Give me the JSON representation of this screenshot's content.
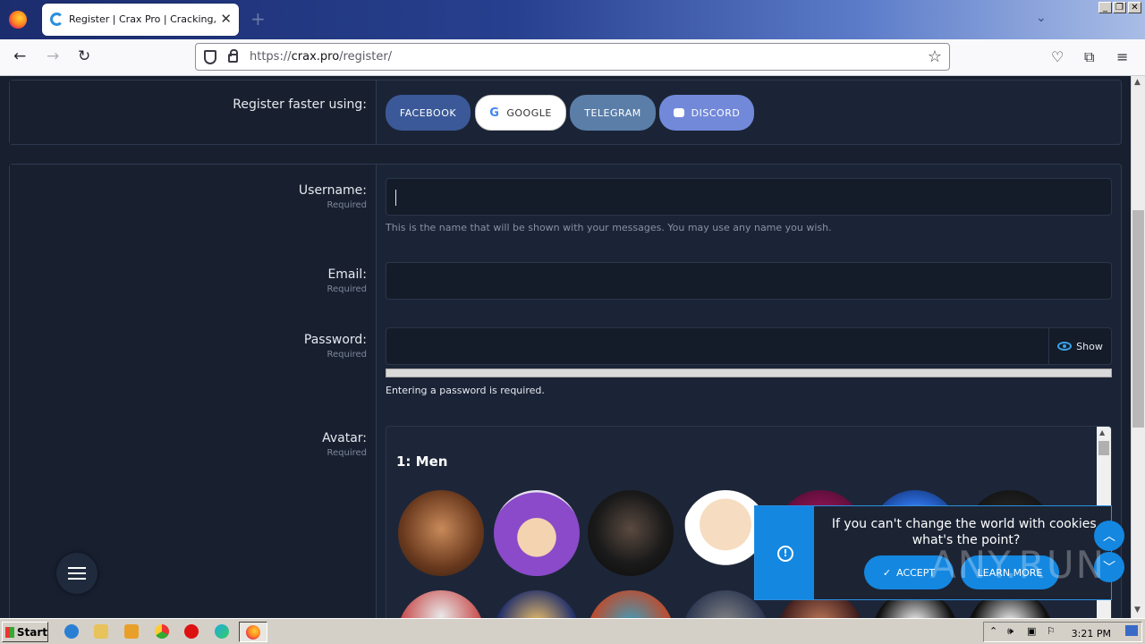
{
  "browser": {
    "tab_title": "Register | Crax Pro | Cracking, Spa",
    "new_tab": "+",
    "url_prefix": "https://",
    "url_host": "crax.pro",
    "url_path": "/register/"
  },
  "social": {
    "label": "Register faster using:",
    "buttons": [
      {
        "label": "FACEBOOK",
        "color": "#3b5998"
      },
      {
        "label": "GOOGLE",
        "color": "#ffffff"
      },
      {
        "label": "TELEGRAM",
        "color": "#5b7ea8"
      },
      {
        "label": "DISCORD",
        "color": "#7289da"
      }
    ]
  },
  "form": {
    "username": {
      "label": "Username:",
      "required": "Required",
      "hint": "This is the name that will be shown with your messages. You may use any name you wish."
    },
    "email": {
      "label": "Email:",
      "required": "Required"
    },
    "password": {
      "label": "Password:",
      "required": "Required",
      "show": "Show",
      "status": "Entering a password is required."
    },
    "avatar": {
      "label": "Avatar:",
      "required": "Required",
      "category": "1: Men"
    }
  },
  "cookie": {
    "line1": "If you can't change the world with cookies,",
    "line2": "what's the point?",
    "accept": "ACCEPT",
    "learn_more": "LEARN MORE"
  },
  "watermark": "ANY.RUN",
  "taskbar": {
    "start": "Start",
    "time": "3:21 PM"
  }
}
